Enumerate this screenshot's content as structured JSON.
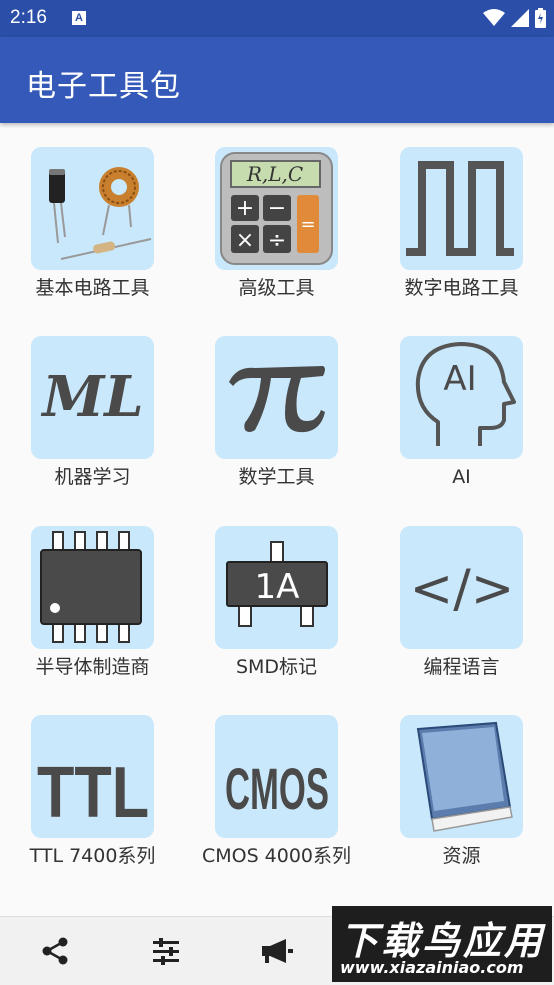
{
  "status_bar": {
    "time": "2:16",
    "notification_badge": "A"
  },
  "app_bar": {
    "title": "电子工具包"
  },
  "tools": [
    {
      "label": "基本电路工具",
      "icon": "components-icon"
    },
    {
      "label": "高级工具",
      "icon": "rlc-calculator-icon",
      "icon_text": "R,L,C"
    },
    {
      "label": "数字电路工具",
      "icon": "square-wave-icon"
    },
    {
      "label": "机器学习",
      "icon": "ml-icon",
      "icon_text": "ML"
    },
    {
      "label": "数学工具",
      "icon": "pi-icon",
      "icon_text": "π"
    },
    {
      "label": "AI",
      "icon": "ai-head-icon",
      "icon_text": "AI"
    },
    {
      "label": "半导体制造商",
      "icon": "ic-chip-icon"
    },
    {
      "label": "SMD标记",
      "icon": "smd-marking-icon",
      "icon_text": "1A"
    },
    {
      "label": "编程语言",
      "icon": "code-icon",
      "icon_text": "</>"
    },
    {
      "label": "TTL 7400系列",
      "icon": "ttl-icon",
      "icon_text": "TTL"
    },
    {
      "label": "CMOS 4000系列",
      "icon": "cmos-icon",
      "icon_text": "CMOS"
    },
    {
      "label": "资源",
      "icon": "book-icon"
    }
  ],
  "bottom_bar": [
    "share-icon",
    "settings-sliders-icon",
    "megaphone-icon",
    "info-icon"
  ],
  "watermark": {
    "main": "下载鸟应用",
    "url": "www.xiazainiao.com"
  },
  "colors": {
    "status_bar": "#2b4fa8",
    "app_bar": "#3559b8",
    "tile_bg": "#c9e8fb"
  }
}
